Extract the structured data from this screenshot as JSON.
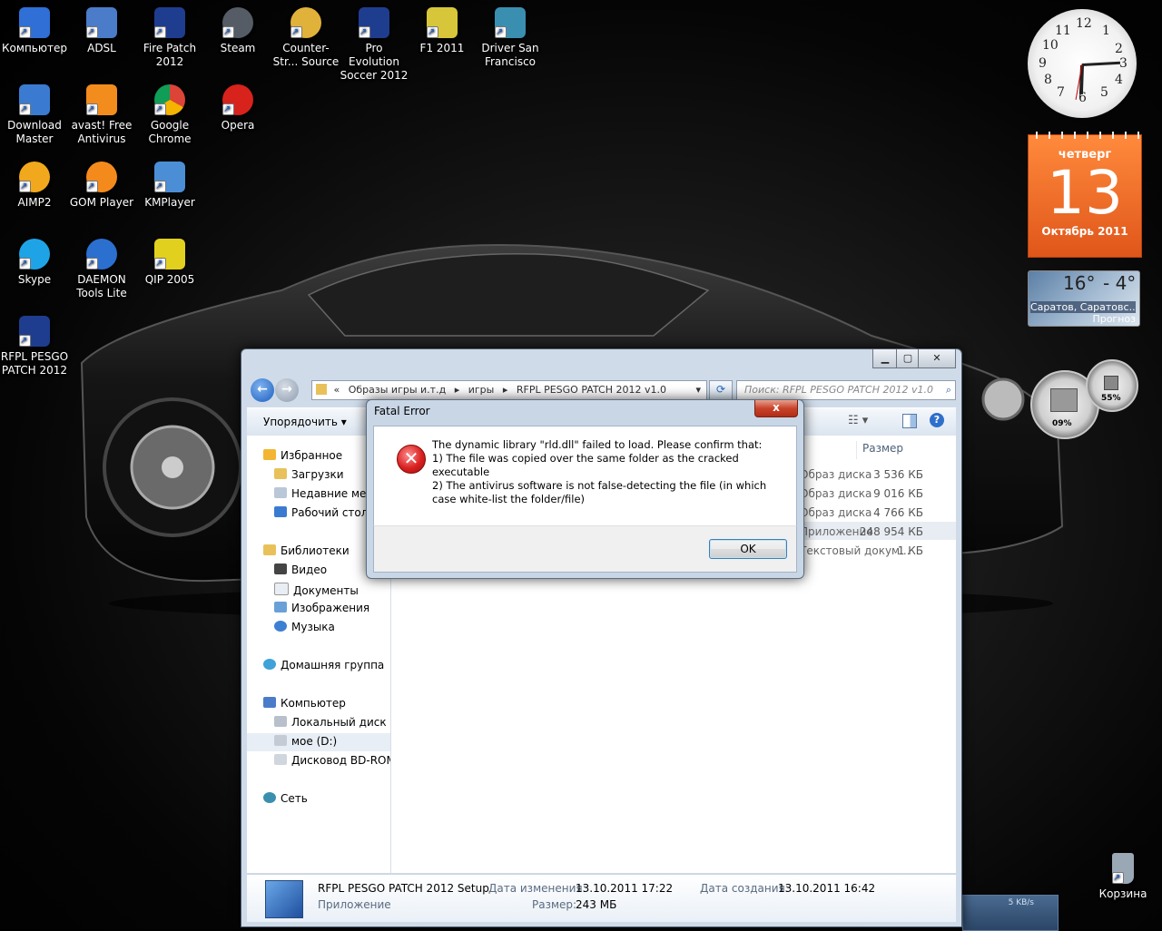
{
  "desktop": {
    "icons": [
      {
        "label": "Компьютер",
        "color": "#2f6fd6"
      },
      {
        "label": "ADSL",
        "color": "#4a7cc9"
      },
      {
        "label": "Fire Patch 2012",
        "color": "#1f3d8f"
      },
      {
        "label": "Steam",
        "color": "#555c66"
      },
      {
        "label": "Counter-Str... Source",
        "color": "#e0b23a"
      },
      {
        "label": "Pro Evolution Soccer 2012",
        "color": "#1f3d8f"
      },
      {
        "label": "F1 2011",
        "color": "#d7c63a"
      },
      {
        "label": "Driver San Francisco",
        "color": "#3a8fb0"
      },
      {
        "label": "Download Master",
        "color": "#3a7bd1"
      },
      {
        "label": "avast! Free Antivirus",
        "color": "#f28c1c"
      },
      {
        "label": "Google Chrome",
        "color": "#2fa244"
      },
      {
        "label": "Opera",
        "color": "#d8221c"
      },
      {
        "label": "AIMP2",
        "color": "#f2a81c"
      },
      {
        "label": "GOM Player",
        "color": "#f58a1c"
      },
      {
        "label": "KMPlayer",
        "color": "#4b8ed6"
      },
      {
        "label": "Skype",
        "color": "#1ea4e6"
      },
      {
        "label": "DAEMON Tools Lite",
        "color": "#2b6fcf"
      },
      {
        "label": "QIP 2005",
        "color": "#e2d01e"
      },
      {
        "label": "RFPL PESGO PATCH 2012",
        "color": "#1f3d8f"
      },
      {
        "label": "Корзина",
        "color": "#9aa7b5"
      }
    ]
  },
  "gadgets": {
    "clock": {
      "numbers": [
        "12",
        "1",
        "2",
        "3",
        "4",
        "5",
        "6",
        "7",
        "8",
        "9",
        "10",
        "11"
      ]
    },
    "calendar": {
      "weekday": "четверг",
      "day": "13",
      "month_year": "Октябрь 2011"
    },
    "weather": {
      "temp_high": "16°",
      "temp_low": "- 4°",
      "city": "Саратов, Саратовс...",
      "forecast_label": "Прогноз"
    },
    "meters": {
      "cpu": "09%",
      "ram": "55%"
    },
    "net": {
      "speed": "5 KB/s"
    }
  },
  "explorer": {
    "address": {
      "chevron": "«",
      "crumbs": [
        "Образы игры и.т.д",
        "игры",
        "RFPL PESGO PATCH 2012 v1.0"
      ]
    },
    "search_placeholder": "Поиск: RFPL PESGO PATCH 2012 v1.0",
    "toolbar": {
      "organize": "Упорядочить"
    },
    "nav": {
      "favorites": "Избранное",
      "downloads": "Загрузки",
      "recent": "Недавние места",
      "desktop": "Рабочий стол",
      "libraries": "Библиотеки",
      "video": "Видео",
      "documents": "Документы",
      "images": "Изображения",
      "music": "Музыка",
      "homegroup": "Домашняя группа",
      "computer": "Компьютер",
      "local_disk": "Локальный диск (C:)",
      "drive_d": "мое  (D:)",
      "bd_rom": "Дисковод BD-ROM",
      "network": "Сеть"
    },
    "columns": {
      "size": "Размер"
    },
    "rows": [
      {
        "type": "Образ диска",
        "size": "3 536 КБ"
      },
      {
        "type": "Образ диска",
        "size": "9 016 КБ"
      },
      {
        "type": "Образ диска",
        "size": "4 766 КБ"
      },
      {
        "type": "Приложение",
        "size": "248 954 КБ"
      },
      {
        "type": "Текстовый докум...",
        "size": "1 КБ"
      }
    ],
    "details": {
      "name": "RFPL PESGO PATCH 2012 Setup",
      "kind": "Приложение",
      "modified_label": "Дата изменения:",
      "modified": "13.10.2011 17:22",
      "created_label": "Дата создания:",
      "created": "13.10.2011 16:42",
      "size_label": "Размер:",
      "size": "243 МБ"
    }
  },
  "dialog": {
    "title": "Fatal Error",
    "close": "x",
    "line1": "The dynamic library \"rld.dll\" failed to load. Please confirm that:",
    "line2": "1) The file was copied over the same folder as the cracked executable",
    "line3": "2) The antivirus software is not false-detecting the file (in which case white-list the folder/file)",
    "ok": "OK"
  }
}
